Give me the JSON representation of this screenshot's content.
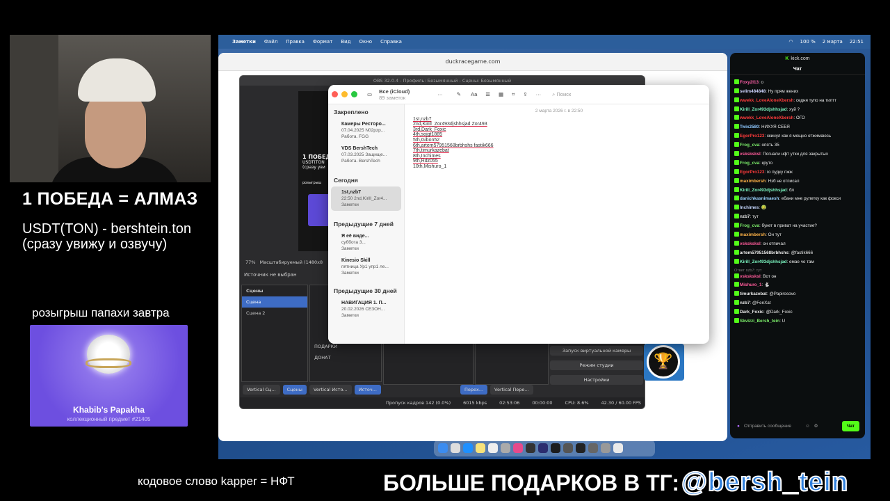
{
  "overlay": {
    "win_text": "1 ПОБЕДА = АЛМАЗ",
    "usdt_line1": "USDT(TON) - bershtein.ton",
    "usdt_line2": "(сразу увижу и озвучу)",
    "raffle": "розыгрыш папахи завтра",
    "gift_name": "Khabib's Papakha",
    "gift_sub": "коллекционный предмет #21405",
    "code_word": "кодовое слово kapper = НФТ",
    "more_gifts": "БОЛЬШЕ ПОДАРКОВ В ТГ:",
    "tg_handle": "@bersh_tein"
  },
  "menubar": {
    "items": [
      "Заметки",
      "Файл",
      "Правка",
      "Формат",
      "Вид",
      "Окно",
      "Справка"
    ],
    "battery": "100 %",
    "date": "2 марта",
    "time": "22:51"
  },
  "browser": {
    "url": "duckracegame.com"
  },
  "obs": {
    "title": "OBS 32.0.4 - Профиль: Безымянный - Сцены: Безымянный",
    "preview_text": "1 ПОБЕД",
    "preview_sub": "USDT(TON",
    "preview_sub2": "(сразу уви",
    "preview_raffle": "розыгрыш",
    "zoom": "77%",
    "scale_label": "Масштабируемый (1480x8",
    "source_none": "Источник не выбран",
    "scenes_header": "Сцены",
    "scenes": [
      "Сцена",
      "Сцена 2"
    ],
    "sources": [
      "ПОДАРКИ",
      "ДОНАТ"
    ],
    "tabs_left": [
      "Vertical Сц...",
      "Сцены"
    ],
    "tabs_mid": [
      "Vertical Исто...",
      "Источ..."
    ],
    "tabs_right": [
      "Перех...",
      "Vertical Пере..."
    ],
    "controls": [
      "Запуск виртуальной камеры",
      "Режим студии",
      "Настройки"
    ],
    "status": {
      "dropped": "Пропуск кадров 142 (0.0%)",
      "kbps": "6015 kbps",
      "time1": "02:53:06",
      "time2": "00:00:00",
      "cpu": "CPU: 8.6%",
      "fps": "42.30 / 60.00 FPS"
    }
  },
  "notes": {
    "folder": "Все (iCloud)",
    "count": "89 заметок",
    "search": "Поиск",
    "pinned_header": "Закреплено",
    "today_header": "Сегодня",
    "week_header": "Предыдущие 7 дней",
    "month_header": "Предыдущие 30 дней",
    "pinned": [
      {
        "title": "Камеры Ресторо...",
        "meta": "07.04.2025  N02pzp...",
        "folder": "Работа. FGG"
      },
      {
        "title": "VDS BershTech",
        "meta": "07.03.2025  Защище...",
        "folder": "Работа. BershTech"
      }
    ],
    "today": [
      {
        "title": "1st,nzb7",
        "meta": "22:50  2nd,Kirill_Zor4...",
        "folder": "Заметки"
      }
    ],
    "week": [
      {
        "title": "Я её виде...",
        "meta": "суббота  3...",
        "folder": "Заметки"
      },
      {
        "title": "Kinesio Skill",
        "meta": "пятница  Ур1 упр1 ле...",
        "folder": "Заметки"
      }
    ],
    "month": [
      {
        "title": "НАВИГАЦИЯ 1. П...",
        "meta": "20.02.2026  СЕЗОН...",
        "folder": "Заметки"
      }
    ],
    "date_line": "2 марта 2026 г. в 22:50",
    "lines": [
      "1st,nzb7",
      "2nd,Kirill_Zor493djshhsjad Zor493",
      "3rd,Dark_Foxic",
      "4th,sojgt1885",
      "5th,Gibon52",
      "6th,artem57951568brbhshs fastik666",
      "7th,timurkazebat",
      "8th,Inchimes",
      "9th,Rdz055",
      "10th,Mishuro_1"
    ]
  },
  "chat": {
    "site": "kick.com",
    "title": "Чат",
    "messages": [
      {
        "user": "Foxy2l13",
        "color": "#ff5fa8",
        "text": "о"
      },
      {
        "user": "selim484848",
        "color": "#cfd6ff",
        "text": "Ну прям жених"
      },
      {
        "user": "wwekk_LoveAloneXbersh",
        "color": "#ff3b3b",
        "text": "седня тупо на тилтт"
      },
      {
        "user": "Kirill_Zor493djshhsjad",
        "color": "#7cf7c1",
        "text": "хуй ?"
      },
      {
        "user": "wwekk_LoveAloneXbersh",
        "color": "#ff3b3b",
        "text": "ОГО"
      },
      {
        "user": "Twix2580",
        "color": "#8ec8ff",
        "text": "НИХУЯ СЕБЯ"
      },
      {
        "user": "EgorPro123",
        "color": "#ff3b3b",
        "text": "скинул как я мощно отжимаюсь"
      },
      {
        "user": "Frog_cva",
        "color": "#7df06b",
        "text": "опять 35"
      },
      {
        "user": "vsksksksl",
        "color": "#ff5b9a",
        "text": "Погнали нфт утки для закрытых"
      },
      {
        "user": "Frog_cva",
        "color": "#7df06b",
        "text": "круто"
      },
      {
        "user": "EgorPro123",
        "color": "#ff3b3b",
        "text": "го пудку пжж"
      },
      {
        "user": "maximbersh",
        "color": "#ffb347",
        "text": "Нзб не отписал"
      },
      {
        "user": "Kirill_Zor493djshhsjad",
        "color": "#7cf7c1",
        "text": "бл"
      },
      {
        "user": "danichkasnimaesh",
        "color": "#9ad4ff",
        "text": "ебани мне рулетку как фокси"
      },
      {
        "user": "Inchimes",
        "color": "#c7d8ff",
        "text": "🤢"
      },
      {
        "user": "nzb7",
        "color": "#e8e8e8",
        "text": "тут"
      },
      {
        "user": "Frog_cva",
        "color": "#7df06b",
        "text": "букет в приват на участие?"
      },
      {
        "user": "maximbersh",
        "color": "#ffb347",
        "text": "Он тут"
      },
      {
        "user": "vsksksksl",
        "color": "#ff5b9a",
        "text": "он отпичал"
      },
      {
        "user": "artem57951568brbhshs",
        "color": "#e8e8e8",
        "text": "@fastik666"
      },
      {
        "user": "Kirill_Zor493djshhsjad",
        "color": "#7cf7c1",
        "text": "емае чо там"
      },
      {
        "user": "vsksksksl",
        "color": "#ff5b9a",
        "text": "Вот он",
        "reply": "Ответ nzb7: тут"
      },
      {
        "user": "Mishuro_1",
        "color": "#ff5b9a",
        "text": "🐇"
      },
      {
        "user": "timurkazebat",
        "color": "#e8e8e8",
        "text": "@Papirosovo"
      },
      {
        "user": "nzb7",
        "color": "#e8e8e8",
        "text": "@FenXat"
      },
      {
        "user": "Dark_Foxic",
        "color": "#e8e8e8",
        "text": "@Dark_Foxic"
      },
      {
        "user": "Skvizzi_Bersh_tein",
        "color": "#7df06b",
        "text": "U"
      }
    ],
    "input_placeholder": "Отправить сообщение",
    "send": "Чат"
  }
}
